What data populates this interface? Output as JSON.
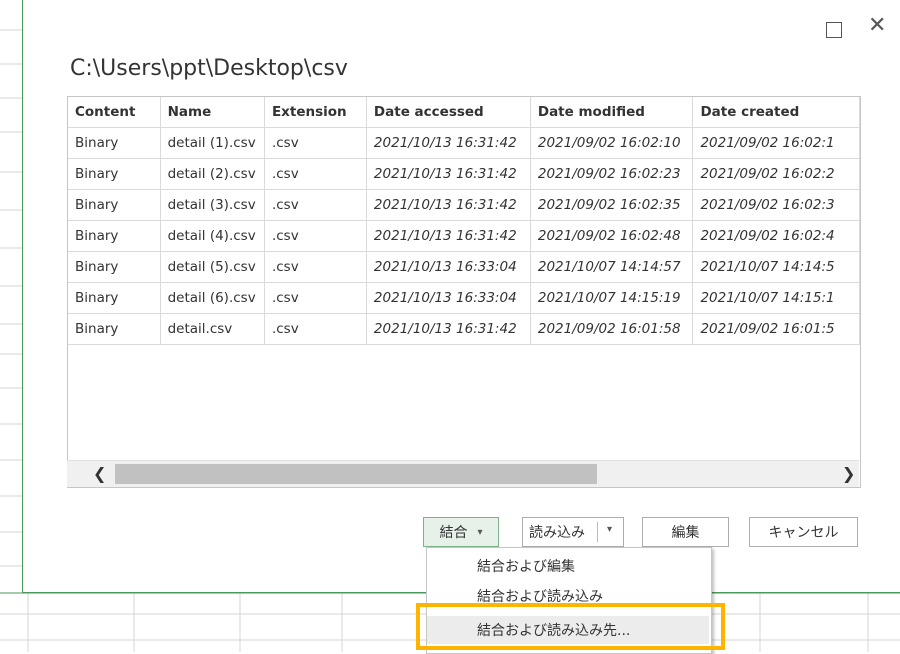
{
  "window": {
    "path_title": "C:\\Users\\ppt\\Desktop\\csv",
    "maximize_label": "",
    "close_label": "✕"
  },
  "table": {
    "headers": [
      "Content",
      "Name",
      "Extension",
      "Date accessed",
      "Date modified",
      "Date created"
    ],
    "rows": [
      [
        "Binary",
        "detail (1).csv",
        ".csv",
        "2021/10/13 16:31:42",
        "2021/09/02 16:02:10",
        "2021/09/02 16:02:1"
      ],
      [
        "Binary",
        "detail (2).csv",
        ".csv",
        "2021/10/13 16:31:42",
        "2021/09/02 16:02:23",
        "2021/09/02 16:02:2"
      ],
      [
        "Binary",
        "detail (3).csv",
        ".csv",
        "2021/10/13 16:31:42",
        "2021/09/02 16:02:35",
        "2021/09/02 16:02:3"
      ],
      [
        "Binary",
        "detail (4).csv",
        ".csv",
        "2021/10/13 16:31:42",
        "2021/09/02 16:02:48",
        "2021/09/02 16:02:4"
      ],
      [
        "Binary",
        "detail (5).csv",
        ".csv",
        "2021/10/13 16:33:04",
        "2021/10/07 14:14:57",
        "2021/10/07 14:14:5"
      ],
      [
        "Binary",
        "detail (6).csv",
        ".csv",
        "2021/10/13 16:33:04",
        "2021/10/07 14:15:19",
        "2021/10/07 14:15:1"
      ],
      [
        "Binary",
        "detail.csv",
        ".csv",
        "2021/10/13 16:31:42",
        "2021/09/02 16:01:58",
        "2021/09/02 16:01:5"
      ]
    ]
  },
  "scroll": {
    "left_arrow": "❮",
    "right_arrow": "❯"
  },
  "buttons": {
    "combine": "結合",
    "combine_caret": "▾",
    "load": "読み込み",
    "load_arrow": "▾",
    "edit": "編集",
    "cancel": "キャンセル"
  },
  "menu": {
    "items": [
      "結合および編集",
      "結合および読み込み",
      "結合および読み込み先..."
    ]
  },
  "colors": {
    "accent_green": "#4a9a5a",
    "highlight": "#ffb400"
  }
}
